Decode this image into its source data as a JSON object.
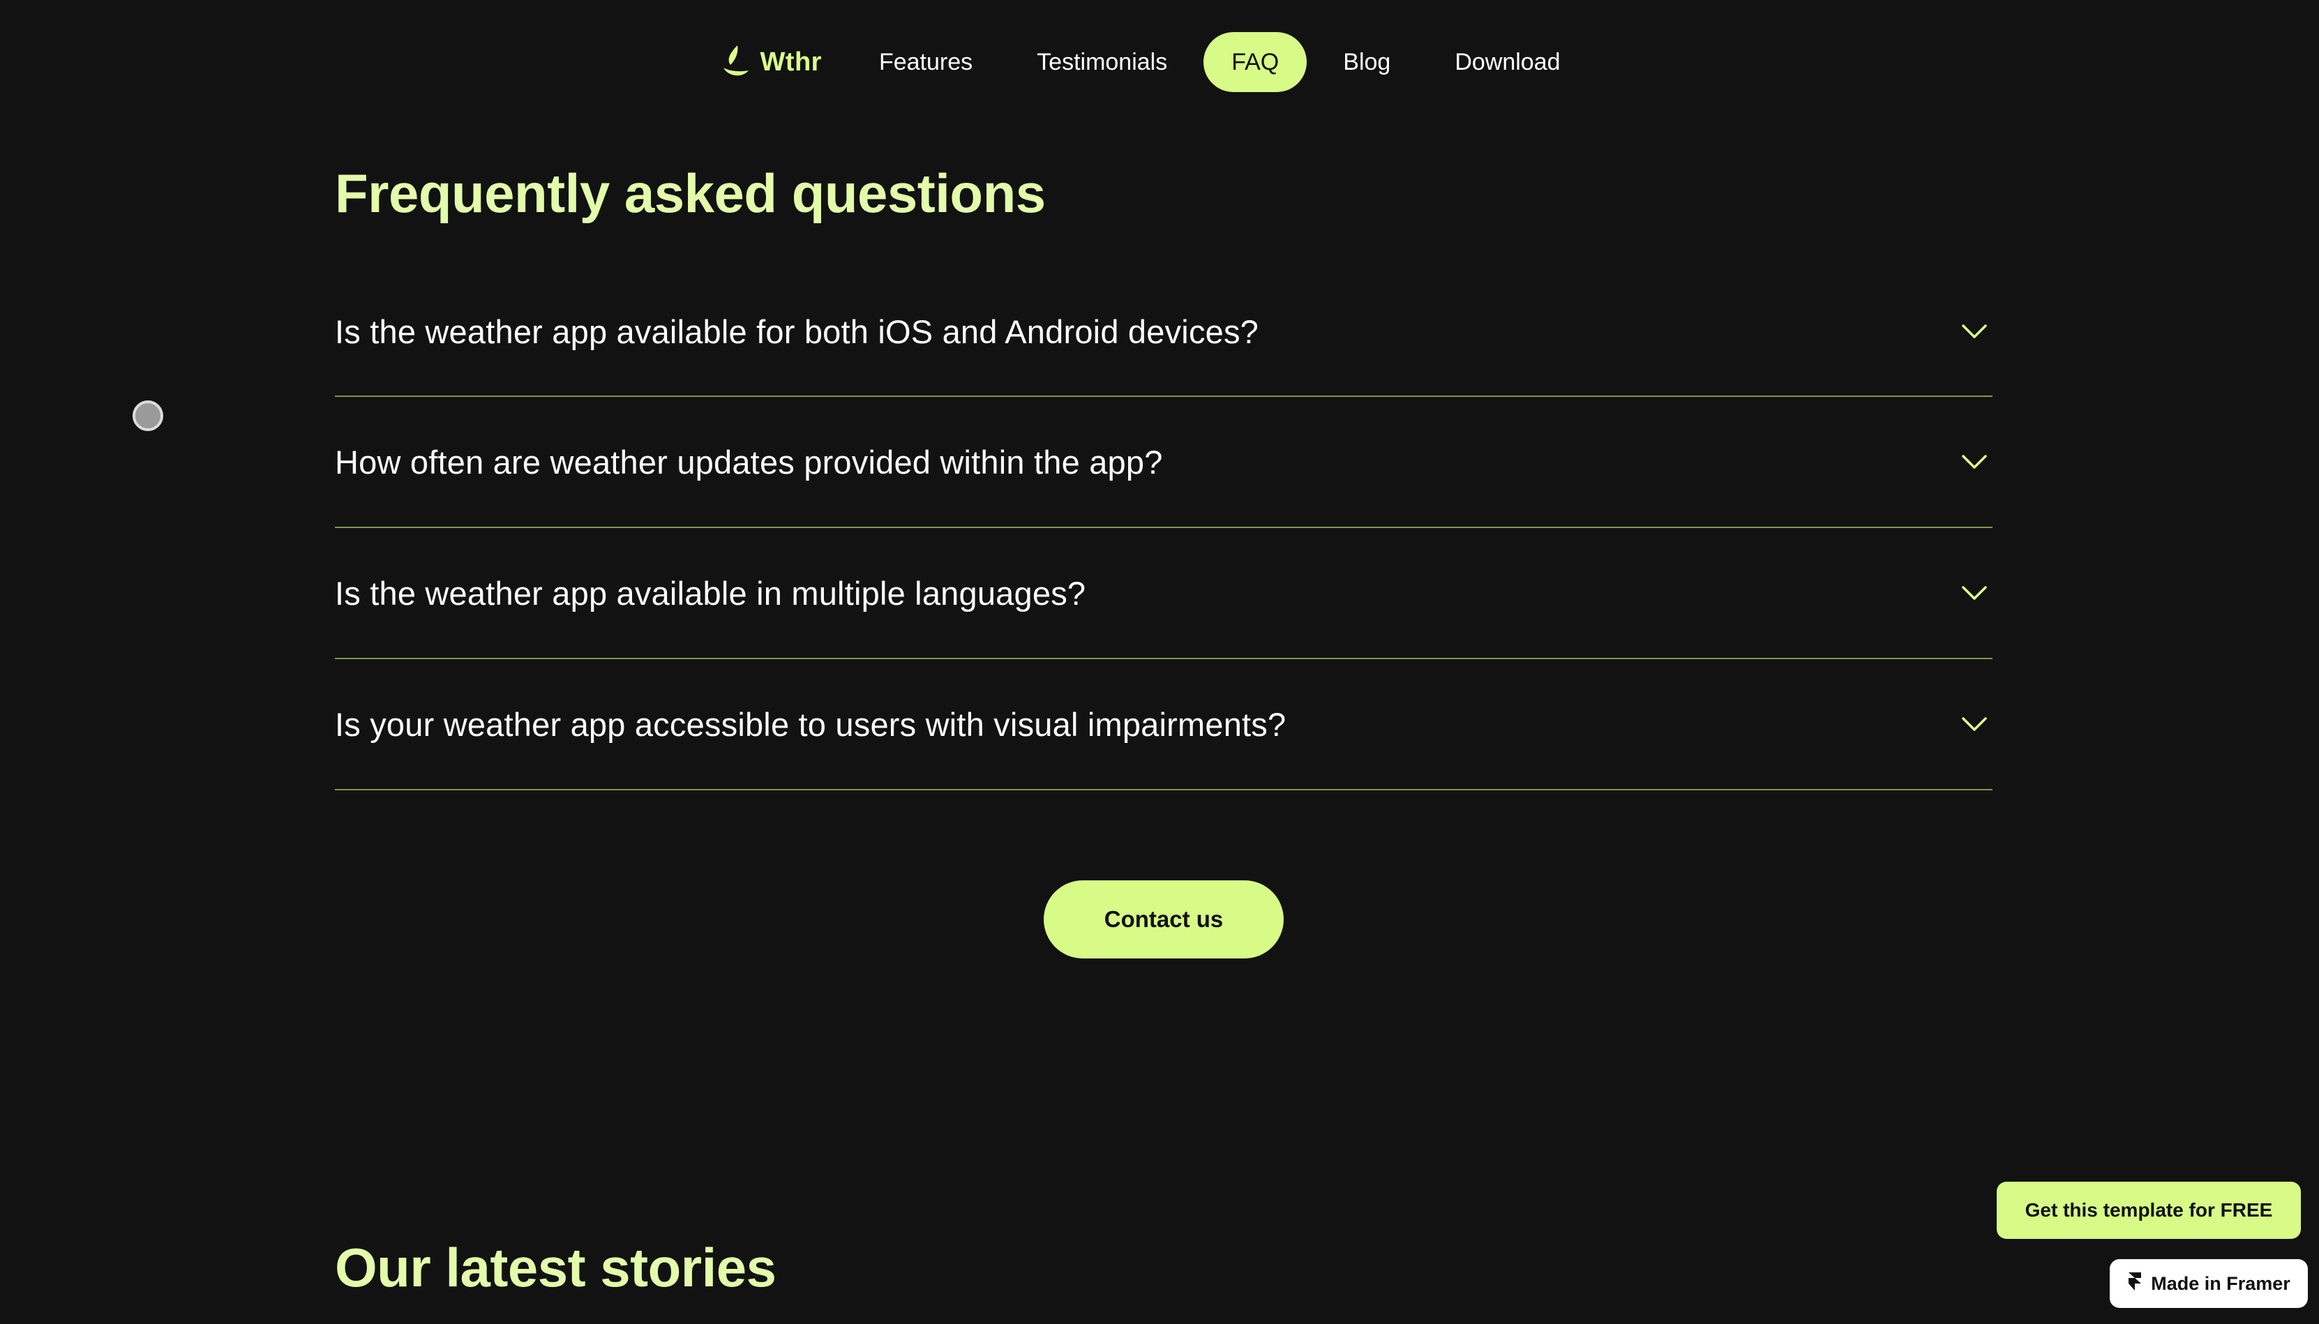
{
  "nav": {
    "logo_text": "Wthr",
    "items": [
      {
        "label": "Features",
        "active": false
      },
      {
        "label": "Testimonials",
        "active": false
      },
      {
        "label": "FAQ",
        "active": true
      },
      {
        "label": "Blog",
        "active": false
      },
      {
        "label": "Download",
        "active": false
      }
    ]
  },
  "faq": {
    "title": "Frequently asked questions",
    "items": [
      {
        "question": "Is the weather app available for both iOS and Android devices?",
        "icon": "chevron-down-icon"
      },
      {
        "question": "How often are weather updates provided within the app?",
        "icon": "chevron-down-icon"
      },
      {
        "question": "Is the weather app available in multiple languages?",
        "icon": "chevron-down-icon"
      },
      {
        "question": "Is your weather app accessible to users with visual impairments?",
        "icon": "chevron-down-icon"
      }
    ],
    "contact_label": "Contact us"
  },
  "stories": {
    "title": "Our latest stories"
  },
  "badges": {
    "template_label": "Get this template for FREE",
    "framer_label": "Made in Framer"
  },
  "colors": {
    "background": "#121212",
    "accent": "#d7fb86",
    "heading": "#e2fcaa",
    "divider": "#7a9a4a",
    "text": "#ffffff"
  }
}
